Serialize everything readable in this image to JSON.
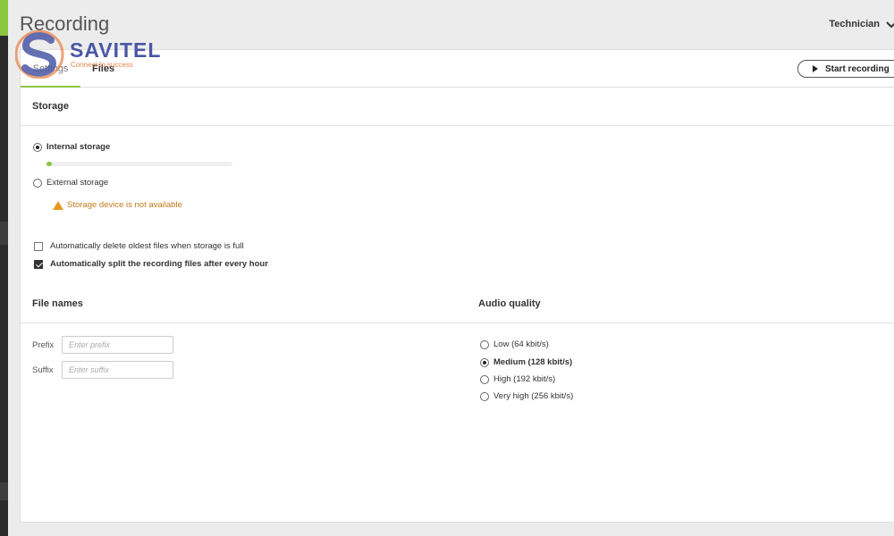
{
  "header": {
    "title": "Recording",
    "user": "Technician"
  },
  "logo": {
    "brand": "SAVITEL",
    "tagline": "Connect to success"
  },
  "tabs": [
    {
      "label": "Settings"
    },
    {
      "label": "Files"
    }
  ],
  "toolbar": {
    "start_label": "Start recording"
  },
  "storage": {
    "heading": "Storage",
    "internal_label": "Internal storage",
    "internal_usage": 0.03,
    "external_label": "External storage",
    "warning": "Storage device is not available",
    "auto_delete_label": "Automatically delete oldest files when storage is full",
    "auto_delete_checked": false,
    "auto_split_label": "Automatically split the recording files after every hour",
    "auto_split_checked": true
  },
  "file_names": {
    "heading": "File names",
    "prefix_label": "Prefix",
    "prefix_placeholder": "Enter prefix",
    "suffix_label": "Suffix",
    "suffix_placeholder": "Enter suffix"
  },
  "audio_quality": {
    "heading": "Audio quality",
    "options": [
      {
        "label": "Low (64 kbit/s)"
      },
      {
        "label": "Medium (128 kbit/s)"
      },
      {
        "label": "High (192 kbit/s)"
      },
      {
        "label": "Very high (256 kbit/s)"
      }
    ],
    "selected": "Medium (128 kbit/s)"
  },
  "colors": {
    "accent": "#8cc63f",
    "warning": "#c27a1c",
    "brand": "#4a57a6",
    "brand_secondary": "#e8844a"
  }
}
